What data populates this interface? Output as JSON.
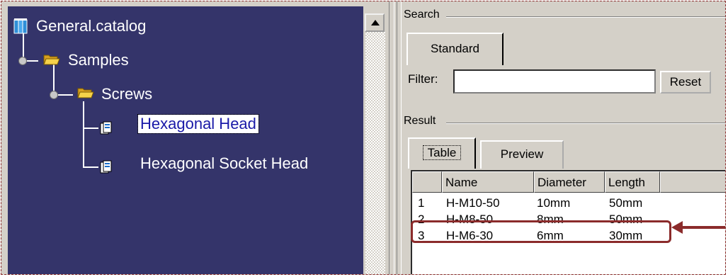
{
  "tree": {
    "root": {
      "label": "General.catalog",
      "icon": "catalog-book-icon"
    },
    "samples": {
      "label": "Samples",
      "icon": "folder-open-icon"
    },
    "screws": {
      "label": "Screws",
      "icon": "folder-open-icon"
    },
    "items": [
      {
        "label": "Hexagonal Head",
        "icon": "document-icon",
        "selected": true
      },
      {
        "label": "Hexagonal Socket Head",
        "icon": "document-icon",
        "selected": false
      }
    ]
  },
  "search": {
    "group_label": "Search",
    "tab_label": "Standard",
    "filter_label": "Filter:",
    "filter_value": "",
    "reset_label": "Reset"
  },
  "result": {
    "group_label": "Result",
    "tabs": [
      {
        "label": "Table",
        "active": true
      },
      {
        "label": "Preview",
        "active": false
      }
    ],
    "columns": [
      "",
      "Name",
      "Diameter",
      "Length"
    ],
    "rows": [
      {
        "index": "1",
        "name": "H-M10-50",
        "diameter": "10mm",
        "length": "50mm"
      },
      {
        "index": "2",
        "name": "H-M8-50",
        "diameter": "8mm",
        "length": "50mm"
      },
      {
        "index": "3",
        "name": "H-M6-30",
        "diameter": "6mm",
        "length": "30mm"
      }
    ]
  },
  "colors": {
    "tree_background": "#34346a",
    "annotation": "#8b2b2b",
    "panel": "#d4d0c8"
  }
}
